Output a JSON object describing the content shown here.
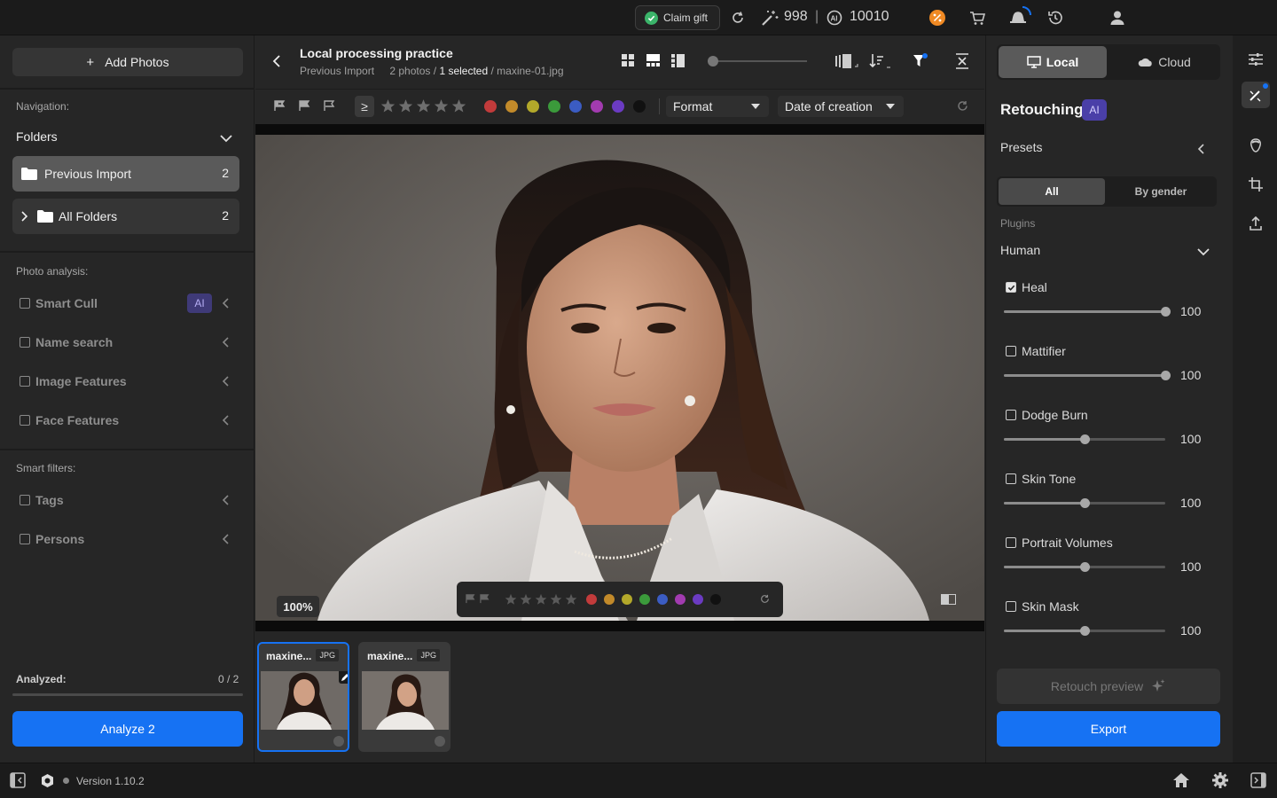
{
  "topbar": {
    "claim_gift": "Claim gift",
    "credits_a": "998",
    "separator": "|",
    "credits_b": "10010",
    "icons": [
      "check-circle-icon",
      "refresh-icon",
      "magic-wand-icon",
      "ai-credits-icon",
      "discount-icon",
      "cart-icon",
      "notifications-icon",
      "history-icon",
      "user-icon"
    ]
  },
  "left": {
    "add_photos": "Add Photos",
    "add_icon": "+",
    "navigation_label": "Navigation:",
    "folders_label": "Folders",
    "folders": [
      {
        "label": "Previous Import",
        "count": "2"
      },
      {
        "label": "All Folders",
        "count": "2"
      }
    ],
    "photo_analysis_label": "Photo analysis:",
    "analysis_items": [
      "Smart Cull",
      "Name search",
      "Image Features",
      "Face Features"
    ],
    "ai_badge": "AI",
    "smart_filters_label": "Smart filters:",
    "filter_items": [
      "Tags",
      "Persons"
    ],
    "analyzed_label": "Analyzed:",
    "analyzed_value": "0 / 2",
    "analyzed_progress": 0,
    "analyze_button": "Analyze 2"
  },
  "header": {
    "title": "Local processing practice",
    "subtitle_folder": "Previous Import",
    "subtitle_count": "2 photos /",
    "subtitle_selected": "1 selected",
    "subtitle_file": "/ maxine-01.jpg"
  },
  "toolbar": {
    "gte": "≥",
    "stars": 5,
    "color_labels": [
      "#c23b3b",
      "#c28a2a",
      "#b3a82a",
      "#3b9a3b",
      "#3b5cc2",
      "#a23bb0",
      "#6b3bc2",
      "#111111"
    ],
    "format_label": "Format",
    "sort_label": "Date of creation"
  },
  "viewer": {
    "zoom": "100%",
    "overlay_stars": 5,
    "overlay_colors": [
      "#c23b3b",
      "#c28a2a",
      "#b3a82a",
      "#3b9a3b",
      "#3b5cc2",
      "#a23bb0",
      "#6b3bc2",
      "#111111"
    ]
  },
  "filmstrip": [
    {
      "name": "maxine...",
      "format": "JPG",
      "selected": true
    },
    {
      "name": "maxine...",
      "format": "JPG",
      "selected": false
    }
  ],
  "right": {
    "tab_local": "Local",
    "tab_cloud": "Cloud",
    "retouching_title": "Retouching",
    "ai_badge": "AI",
    "presets_label": "Presets",
    "seg_all": "All",
    "seg_by_gender": "By gender",
    "plugins_label": "Plugins",
    "plugin_group": "Human",
    "plugins": [
      {
        "label": "Heal",
        "checked": true,
        "value": "100",
        "level": 1.0
      },
      {
        "label": "Mattifier",
        "checked": false,
        "value": "100",
        "level": 1.0
      },
      {
        "label": "Dodge Burn",
        "checked": false,
        "value": "100",
        "level": 0.5
      },
      {
        "label": "Skin Tone",
        "checked": false,
        "value": "100",
        "level": 0.5
      },
      {
        "label": "Portrait Volumes",
        "checked": false,
        "value": "100",
        "level": 0.5
      },
      {
        "label": "Skin Mask",
        "checked": false,
        "value": "100",
        "level": 0.5
      }
    ],
    "retouch_preview": "Retouch preview",
    "export": "Export"
  },
  "bottombar": {
    "version": "Version 1.10.2"
  },
  "colors": {
    "accent": "#1672f3",
    "ai_badge": "#4a3fa8"
  }
}
